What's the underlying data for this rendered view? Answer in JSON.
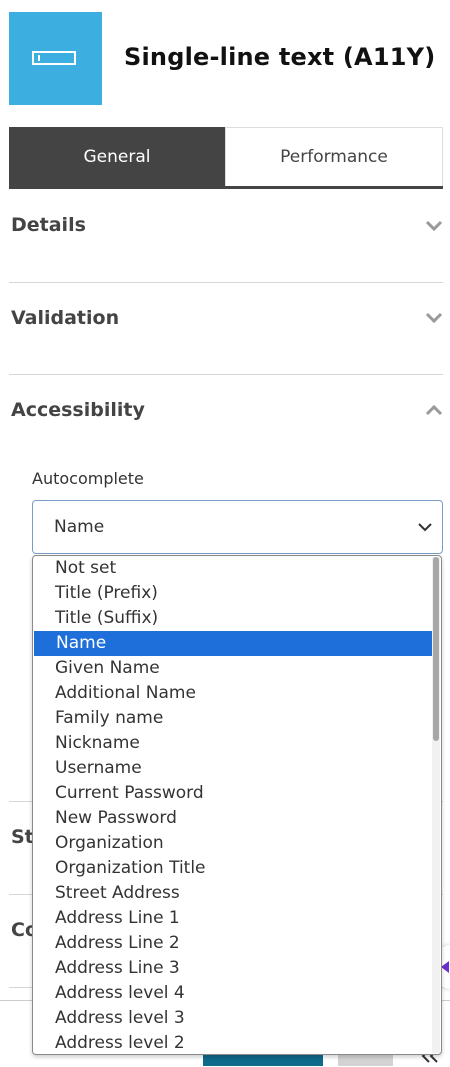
{
  "header": {
    "title": "Single-line text (A11Y)",
    "icon": "text-field-icon",
    "icon_color": "#3daee0"
  },
  "tabs": [
    {
      "label": "General",
      "active": true
    },
    {
      "label": "Performance",
      "active": false
    }
  ],
  "sections": {
    "details": {
      "title": "Details",
      "expanded": false
    },
    "validation": {
      "title": "Validation",
      "expanded": false
    },
    "accessibility": {
      "title": "Accessibility",
      "expanded": true
    },
    "styles_partial": "St",
    "conditions_partial": "Co"
  },
  "autocomplete": {
    "label": "Autocomplete",
    "value": "Name",
    "options": [
      "Not set",
      "Title (Prefix)",
      "Title (Suffix)",
      "Name",
      "Given Name",
      "Additional Name",
      "Family name",
      "Nickname",
      "Username",
      "Current Password",
      "New Password",
      "Organization",
      "Organization Title",
      "Street Address",
      "Address Line 1",
      "Address Line 2",
      "Address Line 3",
      "Address level 4",
      "Address level 3",
      "Address level 2"
    ],
    "selected_index": 3,
    "highlight_color": "#1e6fd9"
  },
  "footer": {
    "apply_color": "#0f6a8b",
    "collapse_icon": "double-chevron-icon"
  }
}
